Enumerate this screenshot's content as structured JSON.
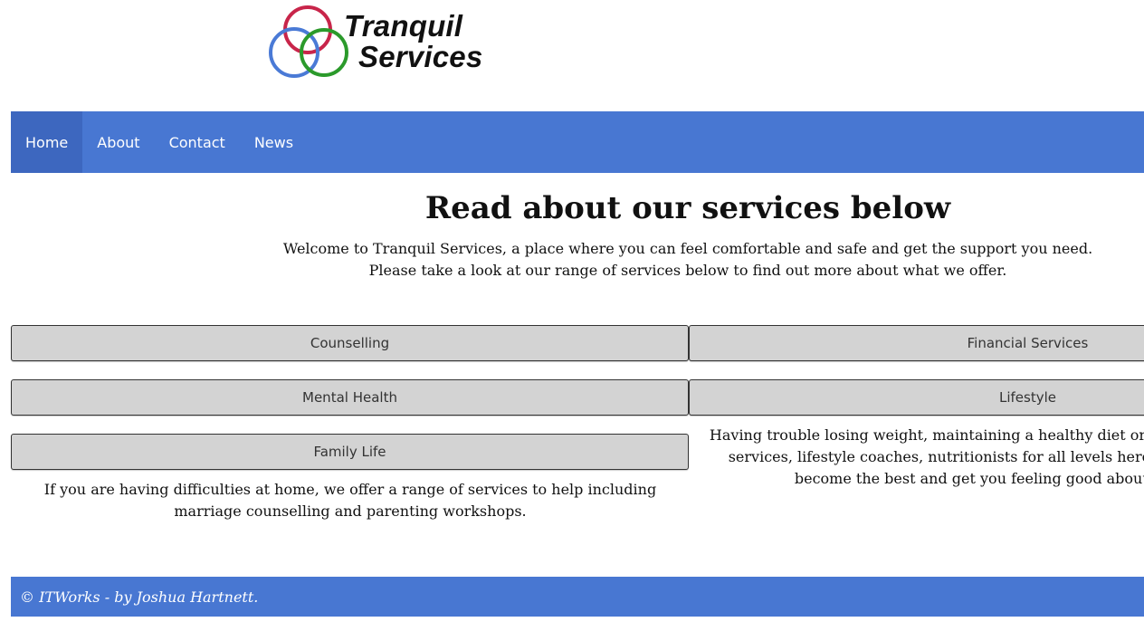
{
  "logo": {
    "line1": "Tranquil",
    "line2": "Services",
    "ring_colors": [
      "#c8254a",
      "#4a7ad6",
      "#2b9a2b"
    ]
  },
  "nav": {
    "items": [
      {
        "label": "Home",
        "active": true
      },
      {
        "label": "About",
        "active": false
      },
      {
        "label": "Contact",
        "active": false
      },
      {
        "label": "News",
        "active": false
      }
    ]
  },
  "main": {
    "heading": "Read about our services below",
    "intro_line1": "Welcome to Tranquil Services, a place where you can feel comfortable and safe and get the support you need.",
    "intro_line2": "Please take a look at our range of services below to find out more about what we offer."
  },
  "services": {
    "left": [
      {
        "label": "Counselling"
      },
      {
        "label": "Mental Health"
      },
      {
        "label": "Family Life",
        "expanded": true,
        "description": "If you are having difficulties at home, we offer a range of services to help including marriage counselling and parenting workshops."
      }
    ],
    "right": [
      {
        "label": "Financial Services"
      },
      {
        "label": "Lifestyle",
        "expanded": true,
        "description": "Having trouble losing weight, maintaining a healthy diet or lifestyle? WE have support services, lifestyle coaches, nutritionists for all levels here and waiting to help you become the best and get you feeling good about yourself again."
      }
    ]
  },
  "footer": {
    "text": "© ITWorks - by Joshua Hartnett."
  },
  "colors": {
    "brand_blue": "#4877d2",
    "active_nav": "#3d67bf",
    "button_grey": "#d3d3d3"
  }
}
